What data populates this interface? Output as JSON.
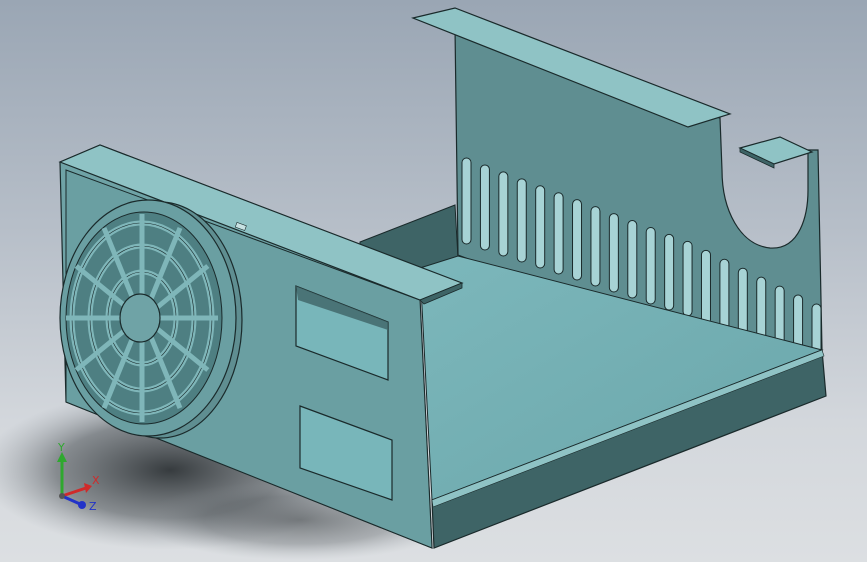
{
  "model": {
    "name": "sheet-metal-enclosure",
    "colors": {
      "face_light": "#8fc3c5",
      "face_mid": "#5f8e91",
      "face_dark": "#3e6466",
      "face_inner": "#78b6ba",
      "edge": "#1a2a2b"
    }
  },
  "triad": {
    "y_label": "Y",
    "x_label": "X",
    "z_label": "Z",
    "colors": {
      "y": "#2fa82f",
      "x": "#d02a2a",
      "z": "#2233c8"
    }
  }
}
